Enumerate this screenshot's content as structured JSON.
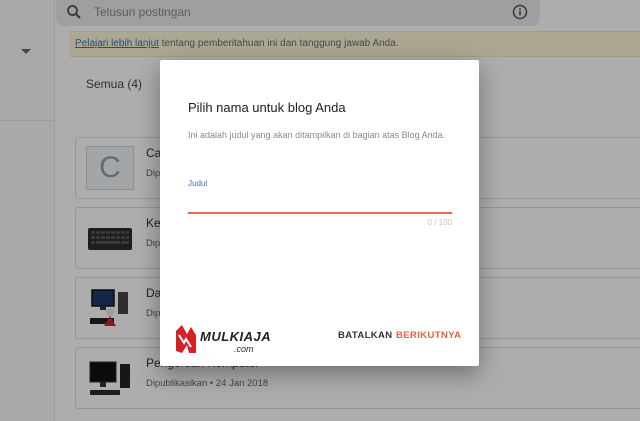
{
  "search": {
    "placeholder": "Telusuri postingan"
  },
  "notice": {
    "link_text": "Pelajari lebih lanjut",
    "text": " tentang pemberitahuan ini dan tanggung jawab Anda."
  },
  "filter": {
    "label": "Semua (4)"
  },
  "posts": [
    {
      "thumb_letter": "C",
      "title": "Ca",
      "meta": "Dip"
    },
    {
      "title": "Ke",
      "meta": "Dip",
      "thumb_icon": "keyboard-thumbnail-icon"
    },
    {
      "title": "Das",
      "meta": "Dip",
      "thumb_icon": "computer-set-thumbnail-icon"
    },
    {
      "title": "Pengertian Komputer",
      "meta": "Dipublikasikan • 24 Jan 2018",
      "thumb_icon": "desktop-computer-thumbnail-icon"
    }
  ],
  "dialog": {
    "title": "Pilih nama untuk blog Anda",
    "description": "Ini adalah judul yang akan ditampilkan di bagian atas Blog Anda.",
    "field_label": "Judul",
    "field_value": "",
    "char_count": "0 / 100",
    "cancel_label": "BATALKAN",
    "next_label": "BERIKUTNYA"
  },
  "watermark": {
    "logo_text": "MULKIAJA",
    "logo_subtext": ".com"
  },
  "colors": {
    "accent": "#e8603f",
    "link": "#3a6fc7",
    "notice_bg": "#fdf6d8",
    "logo_red": "#d42027"
  }
}
